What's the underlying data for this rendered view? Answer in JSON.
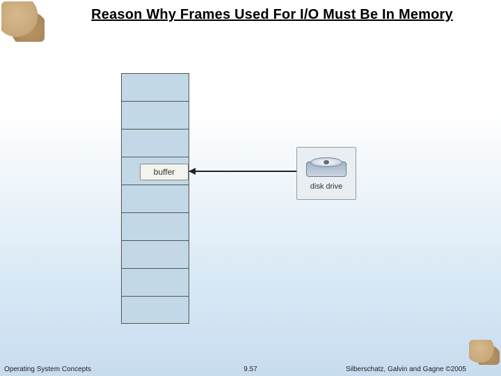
{
  "title": "Reason Why Frames Used For I/O Must Be In Memory",
  "diagram": {
    "buffer_label": "buffer",
    "disk_label": "disk drive"
  },
  "footer": {
    "left": "Operating System Concepts",
    "center": "9.57",
    "right": "Silberschatz, Galvin and Gagne ©2005"
  }
}
